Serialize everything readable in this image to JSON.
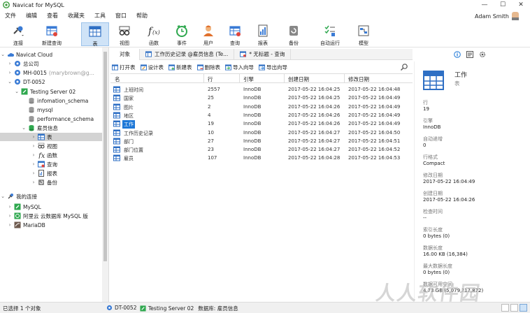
{
  "window": {
    "title": "Navicat for MySQL",
    "min": "—",
    "max": "☐",
    "close": "✕"
  },
  "menu": [
    "文件",
    "编辑",
    "查看",
    "收藏夹",
    "工具",
    "窗口",
    "帮助"
  ],
  "user": {
    "name": "Adam Smith"
  },
  "toolbar": [
    {
      "label": "连接",
      "icon": "connection-icon"
    },
    {
      "label": "新建查询",
      "icon": "new-query-icon"
    },
    {
      "label": "表",
      "icon": "table-icon"
    },
    {
      "label": "视图",
      "icon": "view-icon"
    },
    {
      "label": "函数",
      "icon": "function-icon"
    },
    {
      "label": "事件",
      "icon": "event-icon"
    },
    {
      "label": "用户",
      "icon": "user-icon"
    },
    {
      "label": "查询",
      "icon": "query-icon"
    },
    {
      "label": "报表",
      "icon": "report-icon"
    },
    {
      "label": "备份",
      "icon": "backup-icon"
    },
    {
      "label": "自动运行",
      "icon": "automation-icon"
    },
    {
      "label": "模型",
      "icon": "model-icon"
    }
  ],
  "tree": [
    {
      "label": "Navicat Cloud"
    },
    {
      "label": "总公司"
    },
    {
      "label": "MH-0015",
      "suffix": "(marybrown@g..."
    },
    {
      "label": "DT-0052"
    },
    {
      "label": "Testing Server 02"
    },
    {
      "label": "infomation_schema"
    },
    {
      "label": "mysql"
    },
    {
      "label": "performance_schema"
    },
    {
      "label": "雇员信息"
    },
    {
      "label": "表"
    },
    {
      "label": "视图"
    },
    {
      "label": "函数"
    },
    {
      "label": "查询"
    },
    {
      "label": "报表"
    },
    {
      "label": "备份"
    },
    {
      "label": "我的连接"
    },
    {
      "label": "MySQL"
    },
    {
      "label": "阿里云 云数据库 MySQL 版"
    },
    {
      "label": "MariaDB"
    }
  ],
  "tabs": [
    {
      "label": "对象"
    },
    {
      "label": "工作历史记录 @雇员信息 (Te..."
    },
    {
      "label": "* 无标题 - 查询"
    }
  ],
  "obj_toolbar": [
    "打开表",
    "设计表",
    "新建表",
    "删除表",
    "导入向导",
    "导出向导"
  ],
  "columns": [
    "名",
    "行",
    "引擎",
    "创建日期",
    "修改日期"
  ],
  "rows": [
    {
      "name": "上班时间",
      "rows": "2557",
      "engine": "InnoDB",
      "created": "2017-05-22 16:04:25",
      "modified": "2017-05-22 16:04:48"
    },
    {
      "name": "国家",
      "rows": "25",
      "engine": "InnoDB",
      "created": "2017-05-22 16:04:25",
      "modified": "2017-05-22 16:04:49"
    },
    {
      "name": "图片",
      "rows": "2",
      "engine": "InnoDB",
      "created": "2017-05-22 16:04:26",
      "modified": "2017-05-22 16:04:49"
    },
    {
      "name": "地区",
      "rows": "4",
      "engine": "InnoDB",
      "created": "2017-05-22 16:04:26",
      "modified": "2017-05-22 16:04:49"
    },
    {
      "name": "工作",
      "rows": "19",
      "engine": "InnoDB",
      "created": "2017-05-22 16:04:26",
      "modified": "2017-05-22 16:04:49"
    },
    {
      "name": "工作历史记录",
      "rows": "10",
      "engine": "InnoDB",
      "created": "2017-05-22 16:04:27",
      "modified": "2017-05-22 16:04:50"
    },
    {
      "name": "部门",
      "rows": "27",
      "engine": "InnoDB",
      "created": "2017-05-22 16:04:27",
      "modified": "2017-05-22 16:04:51"
    },
    {
      "name": "部门位置",
      "rows": "23",
      "engine": "InnoDB",
      "created": "2017-05-22 16:04:27",
      "modified": "2017-05-22 16:04:52"
    },
    {
      "name": "雇员",
      "rows": "107",
      "engine": "InnoDB",
      "created": "2017-05-22 16:04:28",
      "modified": "2017-05-22 16:04:53"
    }
  ],
  "info": {
    "name": "工作",
    "type": "表",
    "fields": [
      {
        "k": "行",
        "v": "19"
      },
      {
        "k": "引擎",
        "v": "InnoDB"
      },
      {
        "k": "自动递增",
        "v": "0"
      },
      {
        "k": "行格式",
        "v": "Compact"
      },
      {
        "k": "修改日期",
        "v": "2017-05-22 16:04:49"
      },
      {
        "k": "创建日期",
        "v": "2017-05-22 16:04:26"
      },
      {
        "k": "检查时间",
        "v": "--"
      },
      {
        "k": "索引长度",
        "v": "0 bytes (0)"
      },
      {
        "k": "数据长度",
        "v": "16.00 KB (16,384)"
      },
      {
        "k": "最大数据长度",
        "v": "0 bytes (0)"
      },
      {
        "k": "数据可用空间",
        "v": "4.73 GB (5,079,?17,872)"
      }
    ]
  },
  "status": {
    "selection": "已选择 1 个对象",
    "conn1": "DT-0052",
    "conn2": "Testing Server 02",
    "db": "数据库: 雇员信息"
  },
  "watermark": "人人软件园",
  "colors": {
    "accent": "#1e78d7",
    "green": "#2fa84f",
    "selection": "#cfe3f7"
  }
}
